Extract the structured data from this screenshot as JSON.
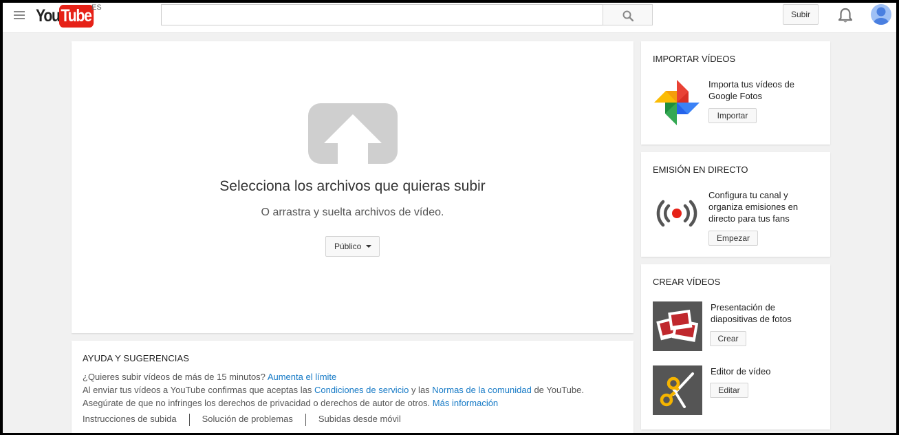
{
  "header": {
    "logo_you": "You",
    "logo_tube": "Tube",
    "country": "ES",
    "search_value": "",
    "upload_label": "Subir"
  },
  "upload": {
    "title": "Selecciona los archivos que quieras subir",
    "subtitle": "O arrastra y suelta archivos de vídeo.",
    "privacy": "Público"
  },
  "help": {
    "title": "AYUDA Y SUGERENCIAS",
    "line1_text": "¿Quieres subir vídeos de más de 15 minutos?",
    "line1_link": "Aumenta el límite",
    "line2_a": "Al enviar tus vídeos a YouTube confirmas que aceptas las",
    "line2_link1": "Condiciones de servicio",
    "line2_b": "y las",
    "line2_link2": "Normas de la comunidad",
    "line2_c": "de YouTube.",
    "line3_text": "Asegúrate de que no infringes los derechos de privacidad o derechos de autor de otros.",
    "line3_link": "Más información",
    "links": [
      "Instrucciones de subida",
      "Solución de problemas",
      "Subidas desde móvil"
    ]
  },
  "import": {
    "title": "IMPORTAR VÍDEOS",
    "text": "Importa tus vídeos de Google Fotos",
    "button": "Importar"
  },
  "live": {
    "title": "EMISIÓN EN DIRECTO",
    "text": "Configura tu canal y organiza emisiones en directo para tus fans",
    "button": "Empezar"
  },
  "create": {
    "title": "CREAR VÍDEOS",
    "slideshow_text": "Presentación de diapositivas de fotos",
    "slideshow_button": "Crear",
    "editor_text": "Editor de vídeo",
    "editor_button": "Editar"
  },
  "colors": {
    "brand_red": "#e62117",
    "link_blue": "#167ac6",
    "background": "#f1f1f1"
  }
}
